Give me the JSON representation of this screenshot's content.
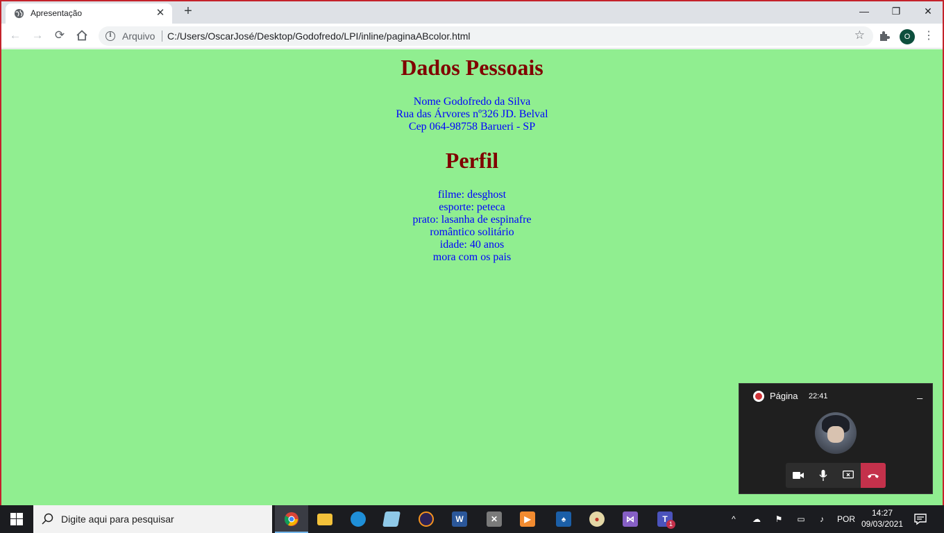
{
  "browser": {
    "tab_title": "Apresentação",
    "omnibox_secure_label": "Arquivo",
    "url": "C:/Users/OscarJosé/Desktop/Godofredo/LPI/inline/paginaABcolor.html",
    "profile_initial": "O"
  },
  "page": {
    "heading1": "Dados Pessoais",
    "personal": [
      "Nome Godofredo da Silva",
      "Rua das Árvores nº326 JD. Belval",
      "Cep 064-98758 Barueri - SP"
    ],
    "heading2": "Perfil",
    "profile": [
      "filme: desghost",
      "esporte: peteca",
      "prato: lasanha de espinafre",
      "romântico solitário",
      "idade: 40 anos",
      "mora com os pais"
    ],
    "colors": {
      "background": "#90ee90",
      "heading": "#800000",
      "text": "#0000ff"
    }
  },
  "meeting": {
    "title": "Página",
    "elapsed": "22:41"
  },
  "taskbar": {
    "search_placeholder": "Digite aqui para pesquisar",
    "language": "POR",
    "time": "14:27",
    "date": "09/03/2021",
    "teams_badge": "1"
  }
}
